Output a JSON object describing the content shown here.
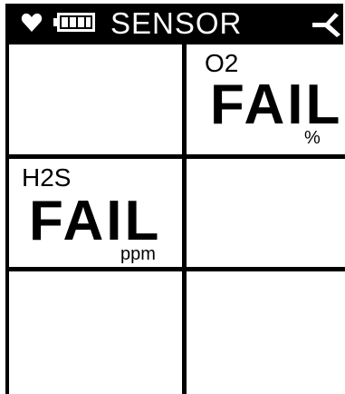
{
  "header": {
    "title": "SENSOR",
    "heart_icon": "heart-icon",
    "battery_icon": "battery-full-icon",
    "signal_icon": "signal-icon",
    "bar_color": "#000000",
    "text_color": "#ffffff"
  },
  "cells": {
    "top_right": {
      "gas": "O2",
      "reading": "FAIL",
      "unit": "%"
    },
    "middle_left": {
      "gas": "H2S",
      "reading": "FAIL",
      "unit": "ppm"
    }
  }
}
